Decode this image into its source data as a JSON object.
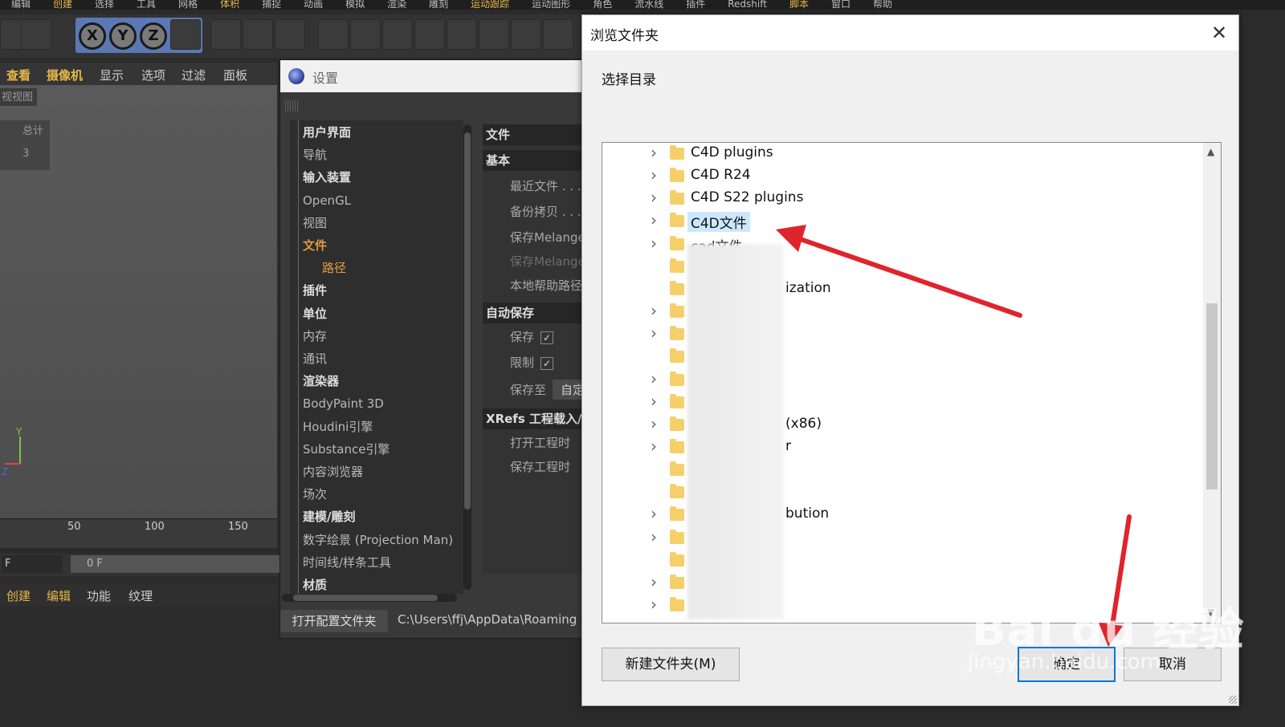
{
  "c4d": {
    "menu": [
      "编辑",
      "创建",
      "选择",
      "工具",
      "网格",
      "体积",
      "捕捉",
      "动画",
      "模拟",
      "渲染",
      "雕刻",
      "运动跟踪",
      "运动图形",
      "角色",
      "流水线",
      "插件",
      "Redshift",
      "脚本",
      "窗口",
      "帮助"
    ],
    "view_menu": [
      "查看",
      "摄像机",
      "显示",
      "选项",
      "过滤",
      "面板"
    ],
    "viewport_label": "视视图",
    "stats_label": "总计",
    "stats_value": "3",
    "timeline_ticks": [
      "50",
      "100",
      "150"
    ],
    "frame_field": "F",
    "frame_value": "0 F",
    "bottom_menu": [
      "创建",
      "编辑",
      "功能",
      "纹理"
    ]
  },
  "settings": {
    "title": "设置",
    "tree": [
      "用户界面",
      "导航",
      "输入装置",
      "OpenGL",
      "视图",
      "文件",
      "路径",
      "插件",
      "单位",
      "内存",
      "通讯",
      "渲染器",
      "BodyPaint 3D",
      "Houdini引擎",
      "Substance引擎",
      "内容浏览器",
      "场次",
      "建模/雕刻",
      "数字绘景 (Projection Man)",
      "时间线/样条工具",
      "材质"
    ],
    "panel": {
      "h_file": "文件",
      "h_basic": "基本",
      "recent": "最近文件 . . .",
      "backup": "备份拷贝 . . .",
      "save_melange": "保存Melange",
      "save_melange2": "保存Melange",
      "help_path": "本地帮助路径",
      "h_autosave": "自动保存",
      "save": "保存",
      "limit": "限制",
      "save_to": "保存至",
      "save_to_value": "自定",
      "h_xrefs": "XRefs 工程载入/",
      "open_proj": "打开工程时",
      "save_proj": "保存工程时"
    },
    "open_config_button": "打开配置文件夹",
    "config_path": "C:\\Users\\ffj\\AppData\\Roaming"
  },
  "dialog": {
    "title": "浏览文件夹",
    "prompt": "选择目录",
    "folders": [
      {
        "name": "C4D  plugins",
        "chevron": true
      },
      {
        "name": "C4D R24",
        "chevron": true
      },
      {
        "name": "C4D S22 plugins",
        "chevron": true
      },
      {
        "name": "C4D文件",
        "chevron": true,
        "selected": true
      },
      {
        "name": "cad文件",
        "chevron": true
      },
      {
        "name": "",
        "chevron": false
      },
      {
        "name": "ization",
        "chevron": false
      },
      {
        "name": "",
        "chevron": true
      },
      {
        "name": "",
        "chevron": true
      },
      {
        "name": "",
        "chevron": false
      },
      {
        "name": "",
        "chevron": true
      },
      {
        "name": "",
        "chevron": true
      },
      {
        "name": "(x86)",
        "chevron": true
      },
      {
        "name": "r",
        "chevron": true
      },
      {
        "name": "",
        "chevron": false
      },
      {
        "name": "",
        "chevron": false
      },
      {
        "name": "bution",
        "chevron": true
      },
      {
        "name": "",
        "chevron": true
      },
      {
        "name": "",
        "chevron": false
      },
      {
        "name": "",
        "chevron": true
      },
      {
        "name": "",
        "chevron": true
      }
    ],
    "new_folder_button": "新建文件夹(M)",
    "ok_button": "确定",
    "cancel_button": "取消"
  },
  "watermark": {
    "line1": "Bai du 经验",
    "line2": "jingyan.baidu.com"
  },
  "colors": {
    "accent": "#e49a3e",
    "arrow": "#e0242c",
    "selection": "#cce8ff",
    "ok_border": "#0078d7"
  }
}
